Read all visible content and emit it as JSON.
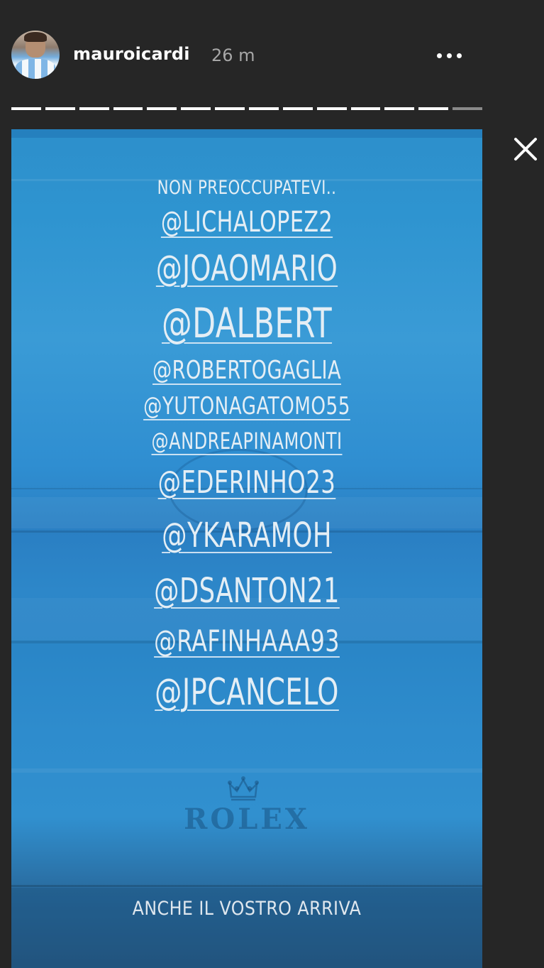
{
  "header": {
    "username": "mauroicardi",
    "time": "26 m"
  },
  "progress": {
    "segments_total": 14,
    "segments_viewed": 13
  },
  "story": {
    "lines": [
      "NON PREOCCUPATEVI..",
      "@LICHALOPEZ2",
      "@JOAOMARIO",
      "@DALBERT",
      "@ROBERTOGAGLIA",
      "@YUTONAGATOMO55",
      "@ANDREAPINAMONTI",
      "@EDERINHO23",
      "@YKARAMOH",
      "@DSANTON21",
      "@RAFINHAAA93",
      "@JPCANCELO"
    ],
    "brand": "ROLEX",
    "footer": "ANCHE IL VOSTRO ARRIVA"
  },
  "icons": {
    "more": "more-horizontal-icon",
    "close": "close-icon",
    "crown": "crown-icon"
  },
  "colors": {
    "background": "#262626",
    "story_blue": "#2e8ccd",
    "text": "#ffffff"
  }
}
